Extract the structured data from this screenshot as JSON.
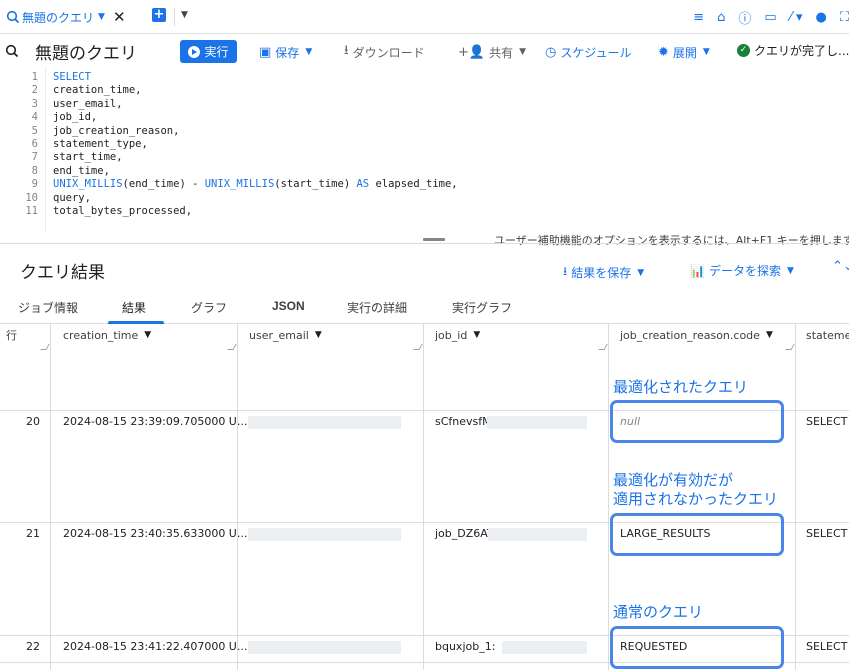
{
  "tab": {
    "label": "無題のクエリ",
    "close": "✕"
  },
  "toolbar": {
    "title": "無題のクエリ",
    "run": "実行",
    "save": "保存",
    "download": "ダウンロード",
    "share": "共有",
    "schedule": "スケジュール",
    "deploy": "展開",
    "status": "クエリが完了し..."
  },
  "editor": {
    "lines": [
      {
        "n": "1",
        "text": "SELECT",
        "kw": true
      },
      {
        "n": "2",
        "text": "creation_time,"
      },
      {
        "n": "3",
        "text": "user_email,"
      },
      {
        "n": "4",
        "text": "job_id,"
      },
      {
        "n": "5",
        "text": "job_creation_reason,"
      },
      {
        "n": "6",
        "text": "statement_type,"
      },
      {
        "n": "7",
        "text": "start_time,"
      },
      {
        "n": "8",
        "text": "end_time,"
      },
      {
        "n": "9",
        "text": "UNIX_MILLIS(end_time) - UNIX_MILLIS(start_time) AS elapsed_time,"
      },
      {
        "n": "10",
        "text": "query,"
      },
      {
        "n": "11",
        "text": "total_bytes_processed,"
      }
    ],
    "hint": "ユーザー補助機能のオプションを表示するには、Alt+F1 キーを押します"
  },
  "results": {
    "title": "クエリ結果",
    "save_results": "結果を保存",
    "explore": "データを探索",
    "tabs": [
      "ジョブ情報",
      "結果",
      "グラフ",
      "JSON",
      "実行の詳細",
      "実行グラフ"
    ],
    "columns": [
      "行",
      "creation_time",
      "user_email",
      "job_id",
      "job_creation_reason.code",
      "stateme"
    ],
    "rows": [
      {
        "row": "20",
        "creation_time": "2024-08-15 23:39:09.705000 U...",
        "job_id": "sCfnevsfM",
        "reason": "null",
        "statement": "SELECT"
      },
      {
        "row": "21",
        "creation_time": "2024-08-15 23:40:35.633000 U...",
        "job_id": "job_DZ6AT",
        "reason": "LARGE_RESULTS",
        "statement": "SELECT"
      },
      {
        "row": "22",
        "creation_time": "2024-08-15 23:41:22.407000 U...",
        "job_id": "bquxjob_1:",
        "reason": "REQUESTED",
        "statement": "SELECT"
      }
    ]
  },
  "annotations": {
    "optimized": "最適化されたクエリ",
    "not_applied_1": "最適化が有効だが",
    "not_applied_2": "適用されなかったクエリ",
    "normal": "通常のクエリ"
  }
}
